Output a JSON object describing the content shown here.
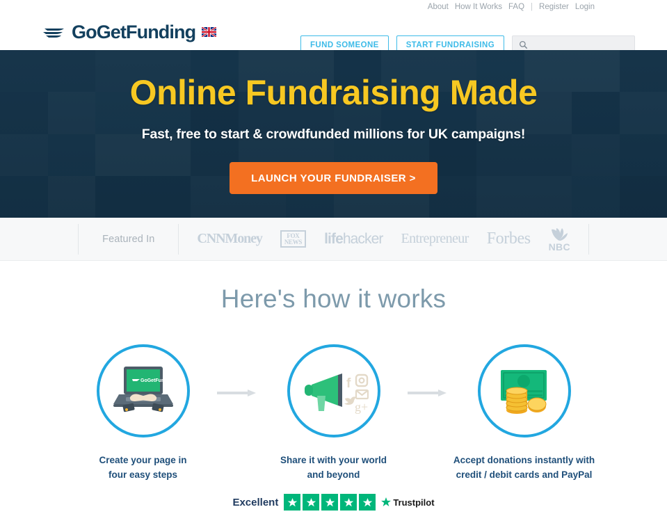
{
  "topnav": {
    "links": [
      "About",
      "How It Works",
      "FAQ"
    ],
    "separator": "|",
    "register": "Register",
    "login": "Login"
  },
  "header": {
    "logo_text": "GoGetFunding",
    "flag_icon": "uk-flag-icon",
    "fund_someone": "FUND SOMEONE",
    "start_fundraising": "START FUNDRAISING",
    "search_placeholder": "",
    "search_value": "",
    "search_icon": "search-icon"
  },
  "hero": {
    "title": "Online Fundraising Made",
    "subtitle": "Fast, free to start & crowdfunded millions for UK campaigns!",
    "cta": "LAUNCH YOUR FUNDRAISER >",
    "cta_color": "#f37021",
    "title_color": "#f7c822"
  },
  "featured": {
    "label": "Featured In",
    "brands": [
      {
        "name": "CNNMoney",
        "lead": "CNN",
        "tail": "Money"
      },
      {
        "name": "FOX NEWS",
        "line1": "FOX",
        "line2": "NEWS"
      },
      {
        "name": "lifehacker",
        "lead": "life",
        "tail": "hacker"
      },
      {
        "name": "Entrepreneur"
      },
      {
        "name": "Forbes"
      },
      {
        "name": "NBC"
      }
    ]
  },
  "how": {
    "title": "Here's how it works",
    "steps": [
      {
        "icon": "laptop-typing-icon",
        "screen_text": "GoGetFunding",
        "line1": "Create your page in",
        "line2": "four easy steps"
      },
      {
        "icon": "megaphone-social-icon",
        "line1": "Share it with your world",
        "line2": "and beyond"
      },
      {
        "icon": "money-coins-icon",
        "line1": "Accept donations instantly with",
        "line2": "credit / debit cards and PayPal"
      }
    ],
    "circle_color": "#22a7e0"
  },
  "trustpilot": {
    "rating_word": "Excellent",
    "stars": 5,
    "star_color": "#00b67a",
    "brand": "Trustpilot"
  }
}
